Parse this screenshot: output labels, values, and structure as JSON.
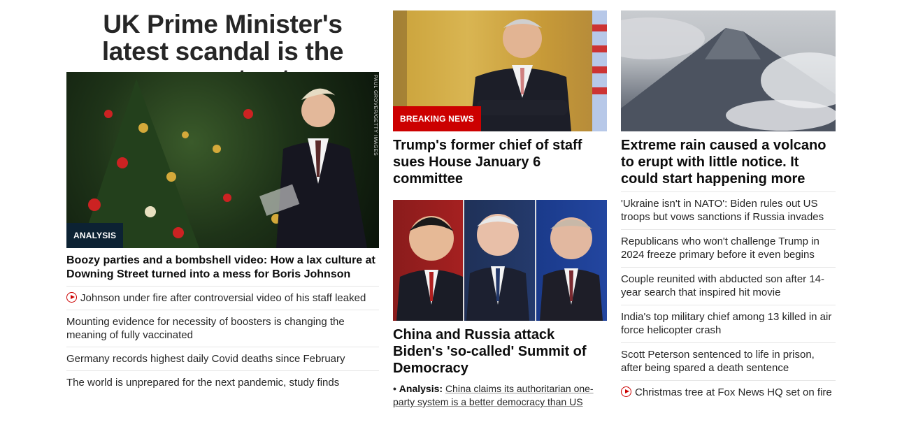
{
  "left": {
    "headline": "UK Prime Minister's latest scandal is the gravest yet",
    "image": {
      "chip": "ANALYSIS",
      "credit": "PAUL GROVER/GETTY IMAGES"
    },
    "story_title": "Boozy parties and a bombshell video: How a lax culture at Downing Street turned into a mess for Boris Johnson",
    "links": [
      {
        "text": "Johnson under fire after controversial video of his staff leaked",
        "icon": "play-icon"
      },
      {
        "text": "Mounting evidence for necessity of boosters is changing the meaning of fully vaccinated"
      },
      {
        "text": "Germany records highest daily Covid deaths since February"
      },
      {
        "text": "The world is unprepared for the next pandemic, study finds"
      }
    ]
  },
  "middle": {
    "story1": {
      "chip": "BREAKING NEWS",
      "title": "Trump's former chief of staff sues House January 6 committee"
    },
    "story2": {
      "title": "China and Russia attack Biden's 'so-called' Summit of Democracy",
      "bullet": "•",
      "kicker": "Analysis:",
      "link": "China claims its authoritarian one-party system is a better democracy than US"
    }
  },
  "right": {
    "title": "Extreme rain caused a volcano to erupt with little notice. It could start happening more",
    "links": [
      {
        "text": "'Ukraine isn't in NATO': Biden rules out US troops but vows sanctions if Russia invades"
      },
      {
        "text": "Republicans who won't challenge Trump in 2024 freeze primary before it even begins"
      },
      {
        "text": "Couple reunited with abducted son after 14-year search that inspired hit movie"
      },
      {
        "text": "India's top military chief among 13 killed in air force helicopter crash"
      },
      {
        "text": "Scott Peterson sentenced to life in prison, after being spared a death sentence"
      },
      {
        "text": "Christmas tree at Fox News HQ set on fire",
        "icon": "play-icon"
      }
    ]
  },
  "colors": {
    "accent": "#cc0000",
    "analysis_chip": "#0c2233"
  }
}
